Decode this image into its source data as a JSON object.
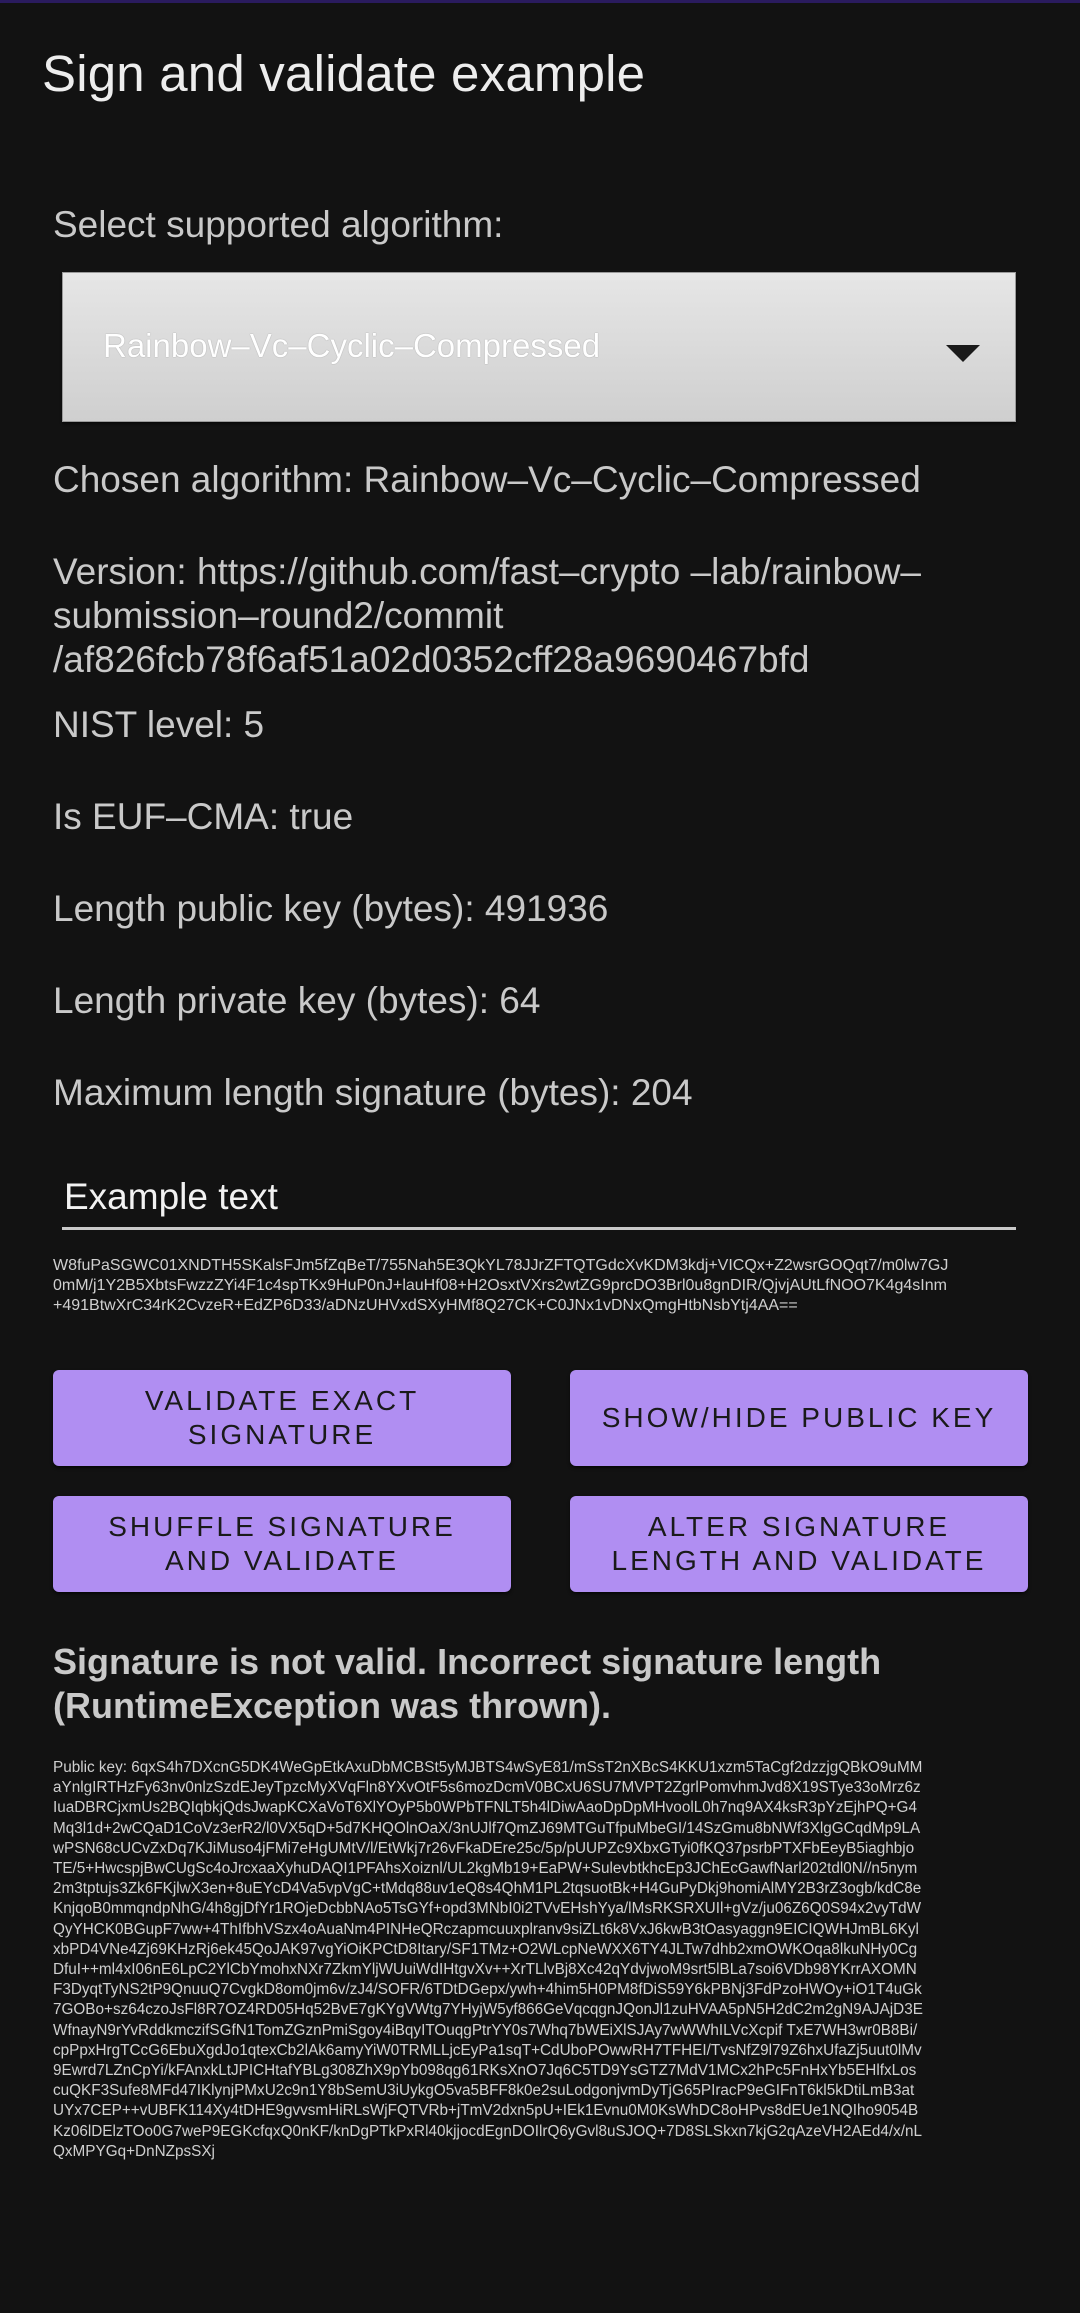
{
  "app": {
    "title": "Sign and validate example"
  },
  "algorithm": {
    "select_label": "Select supported algorithm:",
    "selected": "Rainbow–Vc–Cyclic–Compressed"
  },
  "details": {
    "chosen": "Chosen algorithm: Rainbow–Vc–Cyclic–Compressed",
    "version": "Version: https://github.com/fast–crypto –lab/rainbow–submission–round2/commit /af826fcb78f6af51a02d0352cff28a9690467bfd",
    "nist_level": "NIST level: 5",
    "euf_cma": "Is EUF–CMA: true",
    "public_key_length": "Length public key (bytes): 491936",
    "private_key_length": "Length private key (bytes): 64",
    "max_signature_length": "Maximum length signature (bytes): 204"
  },
  "input": {
    "value": "Example text"
  },
  "signature": "W8fuPaSGWC01XNDTH5SKalsFJm5fZqBeT/755Nah5E3QkYL78JJrZFTQTGdcXvKDM3kdj+VICQx+Z2wsrGOQqt7/m0lw7GJ0mM/j1Y2B5XbtsFwzzZYi4F1c4spTKx9HuP0nJ+lauHf08+H2OsxtVXrs2wtZG9prcDO3Brl0u8gnDIR/QjvjAUtLfNOO7K4g4sInm+491BtwXrC34rK2CvzeR+EdZP6D33/aDNzUHVxdSXyHMf8Q27CK+C0JNx1vDNxQmgHtbNsbYtj4AA==",
  "buttons": {
    "validate": "VALIDATE EXACT SIGNATURE",
    "show_hide": "SHOW/HIDE PUBLIC KEY",
    "shuffle": "SHUFFLE SIGNATURE AND VALIDATE",
    "alter": "ALTER SIGNATURE LENGTH AND VALIDATE"
  },
  "result": "Signature is not valid. Incorrect signature length (RuntimeException was thrown).",
  "public_key": "Public key: 6qxS4h7DXcnG5DK4WeGpEtkAxuDbMCBSt5yMJBTS4wSyE81/mSsT2nXBcS4KKU1xzm5TaCgf2dzzjgQBkO9uMMaYnlgIRTHzFy63nv0nlzSzdEJeyTpzcMyXVqFln8YXvOtF5s6mozDcmV0BCxU6SU7MVPT2ZgrlPomvhmJvd8X19STye33oMrz6zIuaDBRCjxmUs2BQIqbkjQdsJwapKCXaVoT6XlYOyP5b0WPbTFNLT5h4lDiwAaoDpDpMHvoolL0h7nq9AX4ksR3pYzEjhPQ+G4Mq3l1d+2wCQaD1CoVz3erR2/l0VX5qD+5d7KHQOlnOaX/3nUJlf7QmZJ69MTGuTfpuMbeGI/14SzGmu8bNWf3XlgGCqdMp9LAwPSN68cUCvZxDq7KJiMuso4jFMi7eHgUMtV/l/EtWkj7r26vFkaDEre25c/5p/pUUPZc9XbxGTyi0fKQ37psrbPTXFbEeyB5iaghbjoTE/5+HwcspjBwCUgSc4oJrcxaaXyhuDAQI1PFAhsXoiznl/UL2kgMb19+EaPW+SulevbtkhcEp3JChEcGawfNarl202tdl0N//n5nym2m3tptujs3Zk6FKjlwX3en+8uEYcD4Va5vpVgC+tMdq88uv1eQ8s4QhM1PL2tqsuotBk+H4GuPyDkj9homiAlMY2B3rZ3ogb/kdC8eKnjqoB0mmqndpNhG/4h8gjDfYr1ROjeDcbbNAo5TsGYf+opd3MNbI0i2TVvEHshYya/lMsRKSRXUIl+gVz/ju06Z6Q0S94x2vyTdWQyYHCK0BGupF7ww+4ThIfbhVSzx4oAuaNm4PINHeQRczapmcuuxplranv9siZLt6k8VxJ6kwB3tOasyaggn9EICIQWHJmBL6KylxbPD4VNe4Zj69KHzRj6ek45QoJAK97vgYiOiKPCtD8Itary/SF1TMz+O2WLcpNeWXX6TY4JLTw7dhb2xmOWKOqa8lkuNHy0CgDfuI++ml4xI06nE6LpC2YlCbYmohxNXr7ZkmYljWUuiWdIHtgvXv++XrTLlvBj8Xc42qYdvjwoM9srt5lBLa7soi6VDb98YKrrAXOMNF3DyqtTyNS2tP9QnuuQ7CvgkD8om0jm6v/zJ4/SOFR/6TDtDGepx/ywh+4him5H0PM8fDiS59Y6kPBNj3FdPzoHWOy+iO1T4uGk7GOBo+sz64czoJsFl8R7OZ4RD05Hq52BvE7gKYgVWtg7YHyjW5yf866GeVqcqgnJQonJl1zuHVAA5pN5H2dC2m2gN9AJAjD3EWfnayN9rYvRddkmczifSGfN1TomZGznPmiSgoy4iBqyITOuqgPtrYY0s7Whq7bWEiXlSJAy7wWWhILVcXcpif TxE7WH3wr0B8Bi/cpPpxHrgTCcG6EbuXgdJo1qtexCb2lAk6amyYiW0TRMLLjcEyPa1sqT+CdUboPOwwRH7TFHEI/TvsNfZ9l79Z6hxUfaZj5uut0lMv9Ewrd7LZnCpYi/kFAnxkLtJPICHtafYBLg308ZhX9pYb098qg61RKsXnO7Jq6C5TD9YsGTZ7MdV1MCx2hPc5FnHxYb5EHlfxLoscuQKF3Sufe8MFd47IKlynjPMxU2c9n1Y8bSemU3iUykgO5va5BFF8k0e2suLodgonjvmDyTjG65PIracP9eGIFnT6kl5kDtiLmB3atUYx7CEP++vUBFK114Xy4tDHE9gvvsmHiRLsWjFQTVRb+jTmV2dxn5pU+IEk1Evnu0M0KsWhDC8oHPvs8dEUe1NQIho9054BKz06lDElzTOo0G7weP9EGKcfqxQ0nKF/knDgPTkPxRl40kjjocdEgnDOIlrQ6yGvl8uSJOQ+7D8SLSkxn7kjG2qAzeVH2AEd4/x/nLQxMPYGq+DnNZpsSXj"
}
